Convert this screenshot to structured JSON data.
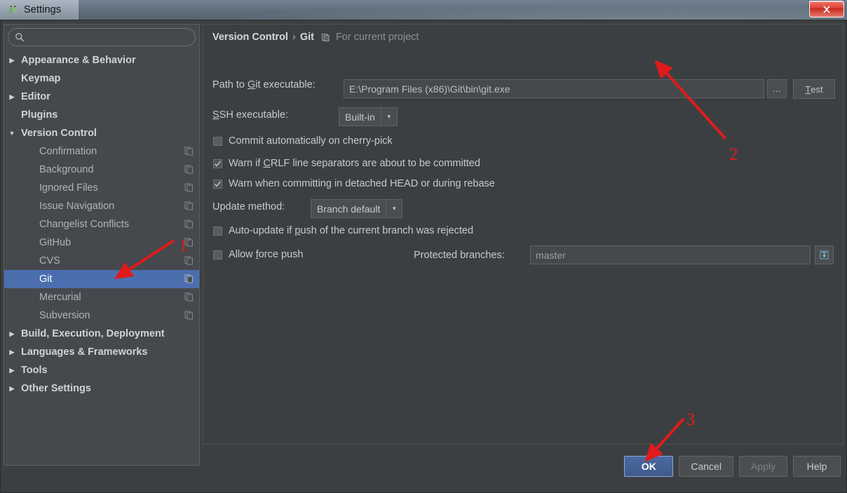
{
  "window": {
    "title": "Settings",
    "app_icon": "android-studio-icon",
    "close_label": "Close"
  },
  "sidebar": {
    "search": {
      "value": "",
      "placeholder": "",
      "icon": "search-icon"
    },
    "items": [
      {
        "label": "Appearance & Behavior",
        "level": 0,
        "twisty": "collapsed",
        "bold": true,
        "icon": null,
        "selected": false
      },
      {
        "label": "Keymap",
        "level": 0,
        "twisty": "none",
        "bold": true,
        "icon": null,
        "selected": false
      },
      {
        "label": "Editor",
        "level": 0,
        "twisty": "collapsed",
        "bold": true,
        "icon": null,
        "selected": false
      },
      {
        "label": "Plugins",
        "level": 0,
        "twisty": "none",
        "bold": true,
        "icon": null,
        "selected": false
      },
      {
        "label": "Version Control",
        "level": 0,
        "twisty": "expanded",
        "bold": true,
        "icon": null,
        "selected": false
      },
      {
        "label": "Confirmation",
        "level": 1,
        "twisty": "none",
        "bold": false,
        "icon": "project-scope-icon",
        "selected": false
      },
      {
        "label": "Background",
        "level": 1,
        "twisty": "none",
        "bold": false,
        "icon": "project-scope-icon",
        "selected": false
      },
      {
        "label": "Ignored Files",
        "level": 1,
        "twisty": "none",
        "bold": false,
        "icon": "project-scope-icon",
        "selected": false
      },
      {
        "label": "Issue Navigation",
        "level": 1,
        "twisty": "none",
        "bold": false,
        "icon": "project-scope-icon",
        "selected": false
      },
      {
        "label": "Changelist Conflicts",
        "level": 1,
        "twisty": "none",
        "bold": false,
        "icon": "project-scope-icon",
        "selected": false
      },
      {
        "label": "GitHub",
        "level": 1,
        "twisty": "none",
        "bold": false,
        "icon": "project-scope-icon",
        "selected": false
      },
      {
        "label": "CVS",
        "level": 1,
        "twisty": "none",
        "bold": false,
        "icon": "project-scope-icon",
        "selected": false
      },
      {
        "label": "Git",
        "level": 1,
        "twisty": "none",
        "bold": false,
        "icon": "project-scope-icon",
        "selected": true
      },
      {
        "label": "Mercurial",
        "level": 1,
        "twisty": "none",
        "bold": false,
        "icon": "project-scope-icon",
        "selected": false
      },
      {
        "label": "Subversion",
        "level": 1,
        "twisty": "none",
        "bold": false,
        "icon": "project-scope-icon",
        "selected": false
      },
      {
        "label": "Build, Execution, Deployment",
        "level": 0,
        "twisty": "collapsed",
        "bold": true,
        "icon": null,
        "selected": false
      },
      {
        "label": "Languages & Frameworks",
        "level": 0,
        "twisty": "collapsed",
        "bold": true,
        "icon": null,
        "selected": false
      },
      {
        "label": "Tools",
        "level": 0,
        "twisty": "collapsed",
        "bold": true,
        "icon": null,
        "selected": false
      },
      {
        "label": "Other Settings",
        "level": 0,
        "twisty": "collapsed",
        "bold": true,
        "icon": null,
        "selected": false
      }
    ]
  },
  "content": {
    "breadcrumb": {
      "root": "Version Control",
      "separator": "›",
      "leaf": "Git",
      "scope_icon": "project-scope-icon",
      "scope_note": "For current project"
    },
    "git_path": {
      "label_pre": "Path to ",
      "label_mnemonic": "G",
      "label_post": "it executable:",
      "label_full": "Path to Git executable:",
      "value": "E:\\Program Files (x86)\\Git\\bin\\git.exe",
      "browse_label": "…",
      "test_label": "Test",
      "test_mnemonic": "T"
    },
    "ssh": {
      "label_full": "SSH executable:",
      "label_mnemonic": "S",
      "label_post": "SH executable:",
      "value": "Built-in",
      "arrow": "▾"
    },
    "checkboxes": [
      {
        "label": "Commit automatically on cherry-pick",
        "checked": false,
        "mnemonic": ""
      },
      {
        "label": "Warn if CRLF line separators are about to be committed",
        "checked": true,
        "mnemonic": "C"
      },
      {
        "label": "Warn when committing in detached HEAD or during rebase",
        "checked": true,
        "mnemonic": ""
      }
    ],
    "update_method": {
      "label": "Update method:",
      "value": "Branch default",
      "arrow": "▾"
    },
    "auto_update": {
      "label": "Auto-update if push of the current branch was rejected",
      "checked": false
    },
    "allow_force_push": {
      "label": "Allow force push",
      "checked": false
    },
    "protected_branches": {
      "label": "Protected branches:",
      "value": "master",
      "expand_icon": "expand-field-icon"
    }
  },
  "footer": {
    "buttons": [
      {
        "label": "OK",
        "style": "default",
        "enabled": true
      },
      {
        "label": "Cancel",
        "style": "normal",
        "enabled": true
      },
      {
        "label": "Apply",
        "style": "disabled",
        "enabled": false
      },
      {
        "label": "Help",
        "style": "normal",
        "enabled": true
      }
    ]
  },
  "annotations": {
    "color": "#e01b1b",
    "markers": [
      {
        "number": "1",
        "target": "sidebar-item-git"
      },
      {
        "number": "2",
        "target": "git-path-input"
      },
      {
        "number": "3",
        "target": "ok-button"
      }
    ]
  }
}
